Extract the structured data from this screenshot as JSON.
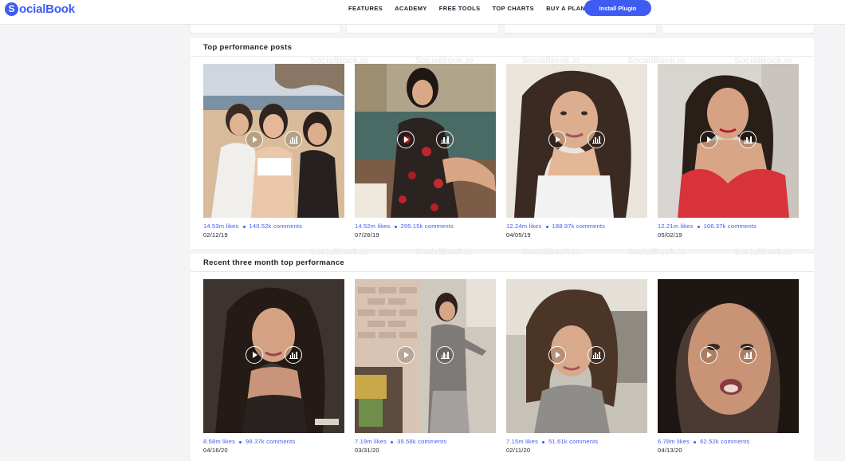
{
  "brand": {
    "logo_mark": "S",
    "name": "ocialBook"
  },
  "nav": {
    "items": [
      "FEATURES",
      "ACADEMY",
      "FREE TOOLS",
      "TOP CHARTS",
      "BUY A PLAN"
    ],
    "cta": "Install Plugin"
  },
  "watermark_text": "SocialBook.io",
  "colors": {
    "accent": "#3e5bf2",
    "page_bg": "#f4f4f6",
    "card_bg": "#ffffff"
  },
  "sections": [
    {
      "title": "Top performance posts",
      "posts": [
        {
          "likes": "14.53m likes",
          "comments": "140.52k comments",
          "date": "02/12/19"
        },
        {
          "likes": "14.52m likes",
          "comments": "295.15k comments",
          "date": "07/26/19"
        },
        {
          "likes": "12.24m likes",
          "comments": "188.97k comments",
          "date": "04/05/19"
        },
        {
          "likes": "12.21m likes",
          "comments": "166.37k comments",
          "date": "05/02/19"
        }
      ]
    },
    {
      "title": "Recent three month top performance",
      "posts": [
        {
          "likes": "8.58m likes",
          "comments": "98.37k comments",
          "date": "04/16/20"
        },
        {
          "likes": "7.19m likes",
          "comments": "39.58k comments",
          "date": "03/31/20"
        },
        {
          "likes": "7.15m likes",
          "comments": "51.61k comments",
          "date": "02/11/20"
        },
        {
          "likes": "6.78m likes",
          "comments": "62.52k comments",
          "date": "04/13/20"
        }
      ]
    }
  ],
  "icons": {
    "play": "play-icon",
    "stats": "bar-chart-icon"
  }
}
